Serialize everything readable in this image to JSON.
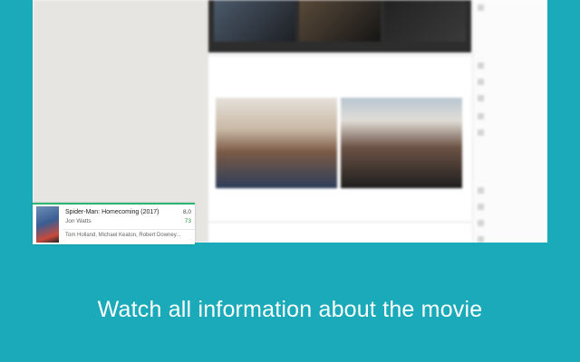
{
  "tagline": "Watch all information about the movie",
  "card": {
    "title": "Spider-Man: Homecoming (2017)",
    "director": "Jon Watts",
    "rating_user": "8,0",
    "rating_meta": "73",
    "cast": "Tom Holland, Michael Keaton, Robert Downey..."
  },
  "colors": {
    "background": "#1aaab9",
    "accent": "#2bb673",
    "meta_green": "#2a9d3a",
    "link": "#4a77c9"
  }
}
